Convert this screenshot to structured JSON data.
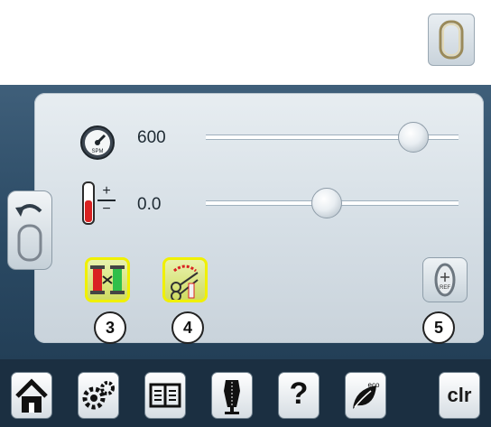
{
  "speed": {
    "value": "600",
    "level_percent": 82
  },
  "tension": {
    "value": "0.0",
    "level_percent": 48
  },
  "functions": [
    {
      "badge": "3"
    },
    {
      "badge": "4"
    },
    {
      "badge": "5"
    }
  ],
  "nav": {
    "help_label": "?",
    "eco_label": "eco",
    "clr_label": "clr"
  },
  "colors": {
    "screen": "#2b4a64",
    "panel": "#d5dee5",
    "active_border": "#f0f000",
    "bottom_bar": "#1b2f41"
  }
}
